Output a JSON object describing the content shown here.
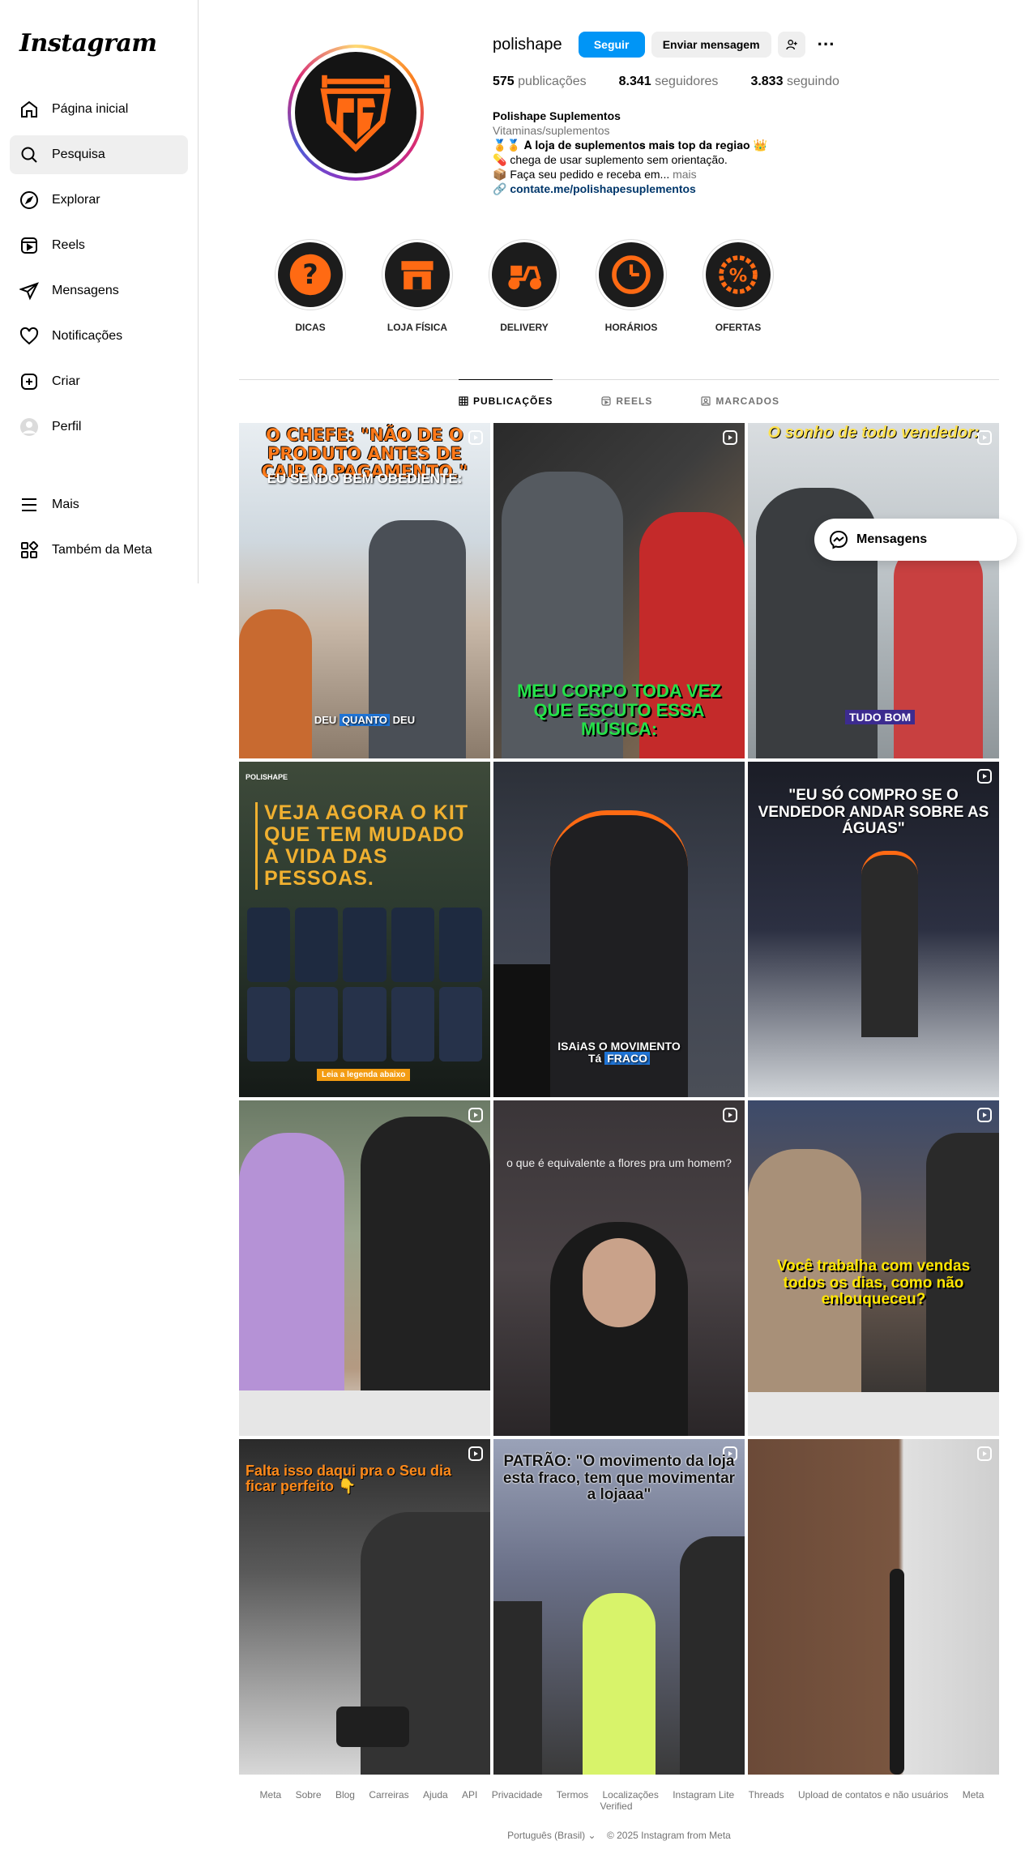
{
  "sidebar": {
    "logo": "Instagram",
    "items": [
      {
        "label": "Página inicial",
        "icon": "home-icon"
      },
      {
        "label": "Pesquisa",
        "icon": "search-icon"
      },
      {
        "label": "Explorar",
        "icon": "compass-icon"
      },
      {
        "label": "Reels",
        "icon": "reels-icon"
      },
      {
        "label": "Mensagens",
        "icon": "send-icon"
      },
      {
        "label": "Notificações",
        "icon": "heart-icon"
      },
      {
        "label": "Criar",
        "icon": "plus-square-icon"
      },
      {
        "label": "Perfil",
        "icon": "avatar-icon"
      }
    ],
    "more": {
      "label": "Mais",
      "icon": "menu-icon"
    },
    "meta": {
      "label": "Também da Meta",
      "icon": "grid-icon"
    }
  },
  "profile": {
    "username": "polishape",
    "follow_label": "Seguir",
    "message_label": "Enviar mensagem",
    "posts_count": "575",
    "posts_label": "publicações",
    "followers_count": "8.341",
    "followers_label": "seguidores",
    "following_count": "3.833",
    "following_label": "seguindo",
    "display_name": "Polishape Suplementos",
    "category": "Vitaminas/suplementos",
    "bio_line1": "🏅🏅 𝐀 𝐥𝐨𝐣𝐚 𝐝𝐞 𝐬𝐮𝐩𝐥𝐞𝐦𝐞𝐧𝐭𝐨𝐬 𝐦𝐚𝐢𝐬 𝐭𝐨𝐩 𝐝𝐚 𝐫𝐞𝐠𝐢𝐚𝐨 👑",
    "bio_line2": "💊 chega de usar suplemento sem orientação.",
    "bio_line3": "📦 Faça seu pedido e receba em...",
    "bio_more": "mais",
    "link": "contate.me/polishapesuplementos"
  },
  "highlights": [
    {
      "label": "DICAS",
      "icon": "question-icon"
    },
    {
      "label": "LOJA FÍSICA",
      "icon": "store-icon"
    },
    {
      "label": "DELIVERY",
      "icon": "scooter-icon"
    },
    {
      "label": "HORÁRIOS",
      "icon": "clock-icon"
    },
    {
      "label": "OFERTAS",
      "icon": "percent-badge-icon"
    }
  ],
  "tabs": [
    {
      "label": "PUBLICAÇÕES",
      "icon": "grid-icon",
      "active": true
    },
    {
      "label": "REELS",
      "icon": "reels-icon",
      "active": false
    },
    {
      "label": "MARCADOS",
      "icon": "tagged-icon",
      "active": false
    }
  ],
  "posts": [
    {
      "top": "O CHEFE: \"NÃO DE O PRODUTO ANTES DE CAIR O PAGAMENTO.\"",
      "sub": "EU SENDO BEM OBEDIENTE:",
      "bottom_a": "DEU ",
      "bottom_b": "QUANTO",
      "bottom_c": " DEU"
    },
    {
      "bottom": "MEU CORPO TODA VEZ QUE ESCUTO ESSA MÚSICA:"
    },
    {
      "top": "O sonho de todo vendedor:",
      "tag": "TUDO BOM"
    },
    {
      "brand": "POLISHAPE",
      "headline": "VEJA AGORA O KIT QUE TEM MUDADO A VIDA DAS PESSOAS.",
      "cta": "Leia a legenda abaixo"
    },
    {
      "bottom_a": "ISAiAS O MOVIMENTO",
      "bottom_b": "Tá ",
      "bottom_c": "FRACO"
    },
    {
      "top": "\"EU SÓ COMPRO SE O VENDEDOR ANDAR SOBRE AS ÁGUAS\""
    },
    {},
    {
      "top": "o que é equivalente a flores pra um homem?"
    },
    {
      "mid": "Você trabalha com vendas todos os dias, como não enlouqueceu?"
    },
    {
      "top": "Falta isso daqui pra o Seu dia ficar perfeito 👇"
    },
    {
      "top": "PATRÃO: \"O movimento da loja esta fraco, tem que movimentar a lojaaa\""
    },
    {}
  ],
  "footer": {
    "links": [
      "Meta",
      "Sobre",
      "Blog",
      "Carreiras",
      "Ajuda",
      "API",
      "Privacidade",
      "Termos",
      "Localizações",
      "Instagram Lite",
      "Threads",
      "Upload de contatos e não usuários",
      "Meta Verified"
    ],
    "language": "Português (Brasil)",
    "copyright": "© 2025 Instagram from Meta"
  },
  "floating_messages": {
    "label": "Mensagens"
  },
  "colors": {
    "accent": "#0095f6",
    "brand_orange": "#ff6a13"
  }
}
